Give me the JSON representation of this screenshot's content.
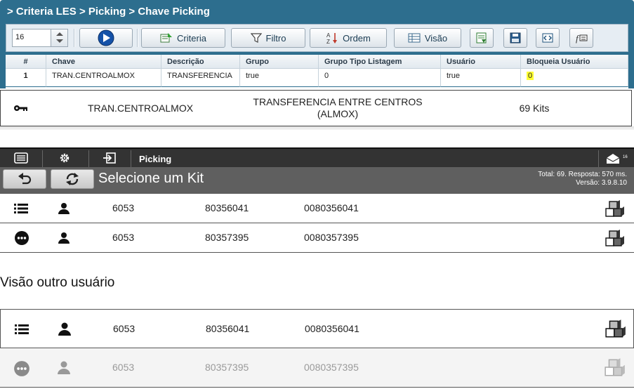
{
  "desktop": {
    "breadcrumb": "> Criteria LES > Picking > Chave Picking",
    "toolbar": {
      "page_size": "16",
      "criteria_label": "Criteria",
      "filtro_label": "Filtro",
      "ordem_label": "Ordem",
      "visao_label": "Visão"
    },
    "grid": {
      "columns": [
        "#",
        "Chave",
        "Descrição",
        "Grupo",
        "Grupo Tipo Listagem",
        "Usuário",
        "Bloqueia Usuário"
      ],
      "rows": [
        [
          "1",
          "TRAN.CENTROALMOX",
          "TRANSFERENCIA",
          "true",
          "0",
          "true",
          "0"
        ]
      ]
    }
  },
  "detail": {
    "chave": "TRAN.CENTROALMOX",
    "descricao_line1": "TRANSFERENCIA ENTRE CENTROS",
    "descricao_line2": "(ALMOX)",
    "kits": "69 Kits"
  },
  "mobile": {
    "screen": "Picking",
    "title": "Selecione um Kit",
    "status_line1": "Total: 69. Resposta: 570 ms.",
    "status_line2": "Versão: 3.9.8.10",
    "badge": "16",
    "rows": [
      {
        "c1": "6053",
        "c2": "80356041",
        "c3": "0080356041"
      },
      {
        "c1": "6053",
        "c2": "80357395",
        "c3": "0080357395"
      }
    ]
  },
  "caption": "Visão outro usuário",
  "other_user": {
    "rows": [
      {
        "c1": "6053",
        "c2": "80356041",
        "c3": "0080356041"
      },
      {
        "c1": "6053",
        "c2": "80357395",
        "c3": "0080357395"
      }
    ]
  },
  "colors": {
    "header_blue": "#2d6e8e",
    "highlight": "#ffff33",
    "dark_bar": "#333333",
    "head_gray": "#5f5f5f"
  }
}
